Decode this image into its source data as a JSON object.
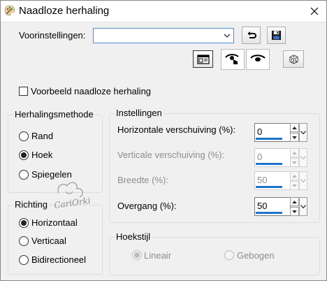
{
  "window": {
    "title": "Naadloze herhaling",
    "app_icon": "paint-palette-icon",
    "close_icon": "close-icon"
  },
  "presets": {
    "label": "Voorinstellingen:",
    "value": "",
    "reset_icon": "reset-arrow-icon",
    "save_icon": "floppy-disk-icon"
  },
  "toolbar": {
    "window_icon": "window-toggle-icon",
    "eye_left_icon": "eye-proof-icon",
    "eye_right_icon": "eye-preview-icon",
    "dice_icon": "dice-randomize-icon"
  },
  "preview": {
    "label": "Voorbeeld naadloze herhaling",
    "checked": false
  },
  "method": {
    "title": "Herhalingsmethode",
    "options": [
      {
        "label": "Rand",
        "selected": false
      },
      {
        "label": "Hoek",
        "selected": true
      },
      {
        "label": "Spiegelen",
        "selected": false
      }
    ]
  },
  "direction": {
    "title": "Richting",
    "options": [
      {
        "label": "Horizontaal",
        "selected": true
      },
      {
        "label": "Verticaal",
        "selected": false
      },
      {
        "label": "Bidirectioneel",
        "selected": false
      }
    ]
  },
  "settings": {
    "title": "Instellingen",
    "fields": [
      {
        "label": "Horizontale verschuiving (%):",
        "value": "0",
        "enabled": true,
        "level": 0.8
      },
      {
        "label": "Verticale verschuiving (%):",
        "value": "0",
        "enabled": false,
        "level": 0.8
      },
      {
        "label": "Breedte (%):",
        "value": "50",
        "enabled": false,
        "level": 0.8
      },
      {
        "label": "Overgang (%):",
        "value": "50",
        "enabled": true,
        "level": 0.8
      }
    ]
  },
  "corner": {
    "title": "Hoekstijl",
    "options": [
      {
        "label": "Lineair",
        "selected": true,
        "enabled": false
      },
      {
        "label": "Gebogen",
        "selected": false,
        "enabled": false
      }
    ]
  },
  "watermark": {
    "text": "CariOrki"
  }
}
